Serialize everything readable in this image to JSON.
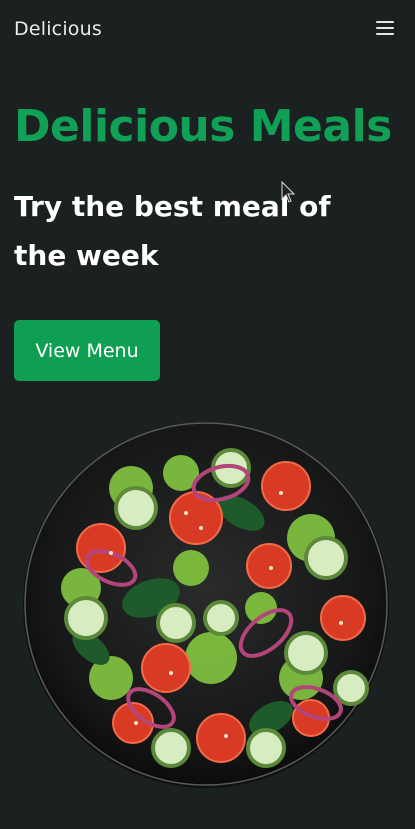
{
  "header": {
    "brand": "Delicious",
    "menu_icon": "hamburger-menu-icon"
  },
  "hero": {
    "title": "Delicious Meals",
    "subtitle": "Try the best meal of the week",
    "cta_label": "View Menu"
  },
  "colors": {
    "background": "#1b2020",
    "accent": "#10a056",
    "button": "#0f9f52",
    "text": "#ffffff"
  },
  "image": {
    "subject": "salad-bowl"
  }
}
